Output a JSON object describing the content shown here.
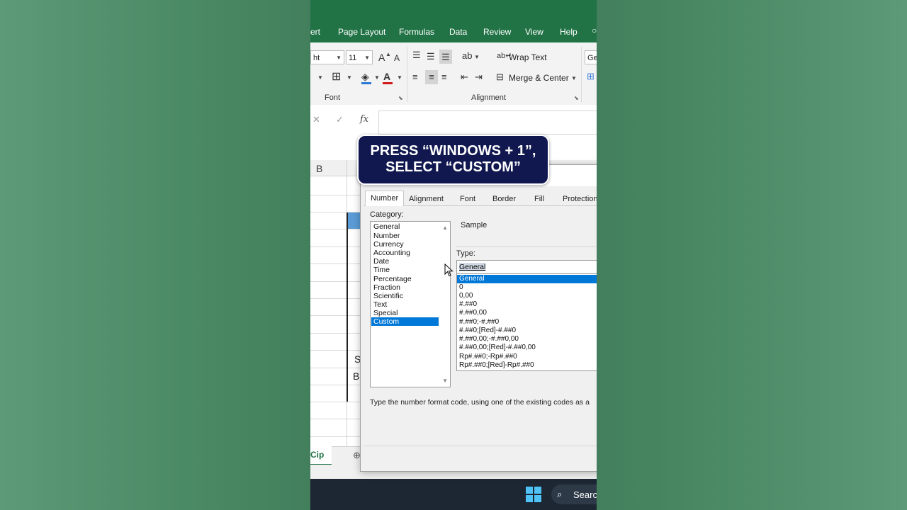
{
  "ribbon_tabs": [
    "ert",
    "Page Layout",
    "Formulas",
    "Data",
    "Review",
    "View",
    "Help"
  ],
  "font_group": {
    "font_name": "ht",
    "font_size": "11",
    "grow_icon": "A",
    "shrink_icon": "A",
    "label": "Font"
  },
  "alignment_group": {
    "wrap_text": "Wrap Text",
    "merge_center": "Merge & Center",
    "label": "Alignment"
  },
  "number_group": {
    "format_value": "Ge"
  },
  "formula_bar": {
    "cancel": "✕",
    "enter": "✓",
    "fx": "fx"
  },
  "grid": {
    "column_header": "B",
    "cell_s": "S",
    "cell_b": "B"
  },
  "sheet_tab": {
    "name": "Cip"
  },
  "taskbar": {
    "search": "Searc"
  },
  "overlay": {
    "line1": "PRESS “WINDOWS + 1”,",
    "line2": "SELECT “CUSTOM”"
  },
  "dialog": {
    "tabs": [
      "Number",
      "Alignment",
      "Font",
      "Border",
      "Fill",
      "Protection"
    ],
    "category_label": "Category:",
    "categories": [
      "General",
      "Number",
      "Currency",
      "Accounting",
      "Date",
      "Time",
      "Percentage",
      "Fraction",
      "Scientific",
      "Text",
      "Special",
      "Custom"
    ],
    "selected_category": "Custom",
    "sample_label": "Sample",
    "type_label": "Type:",
    "type_value": "General",
    "type_list": [
      "General",
      "0",
      "0,00",
      "#.##0",
      "#.##0,00",
      "#.##0;-#.##0",
      "#.##0;[Red]-#.##0",
      "#.##0,00;-#.##0,00",
      "#.##0,00;[Red]-#.##0,00",
      "Rp#.##0;-Rp#.##0",
      "Rp#.##0;[Red]-Rp#.##0"
    ],
    "hint": "Type the number format code, using one of the existing codes as a"
  },
  "colors": {
    "excel_green": "#217346",
    "selection_blue": "#0078d7",
    "overlay_navy": "#11184f"
  }
}
